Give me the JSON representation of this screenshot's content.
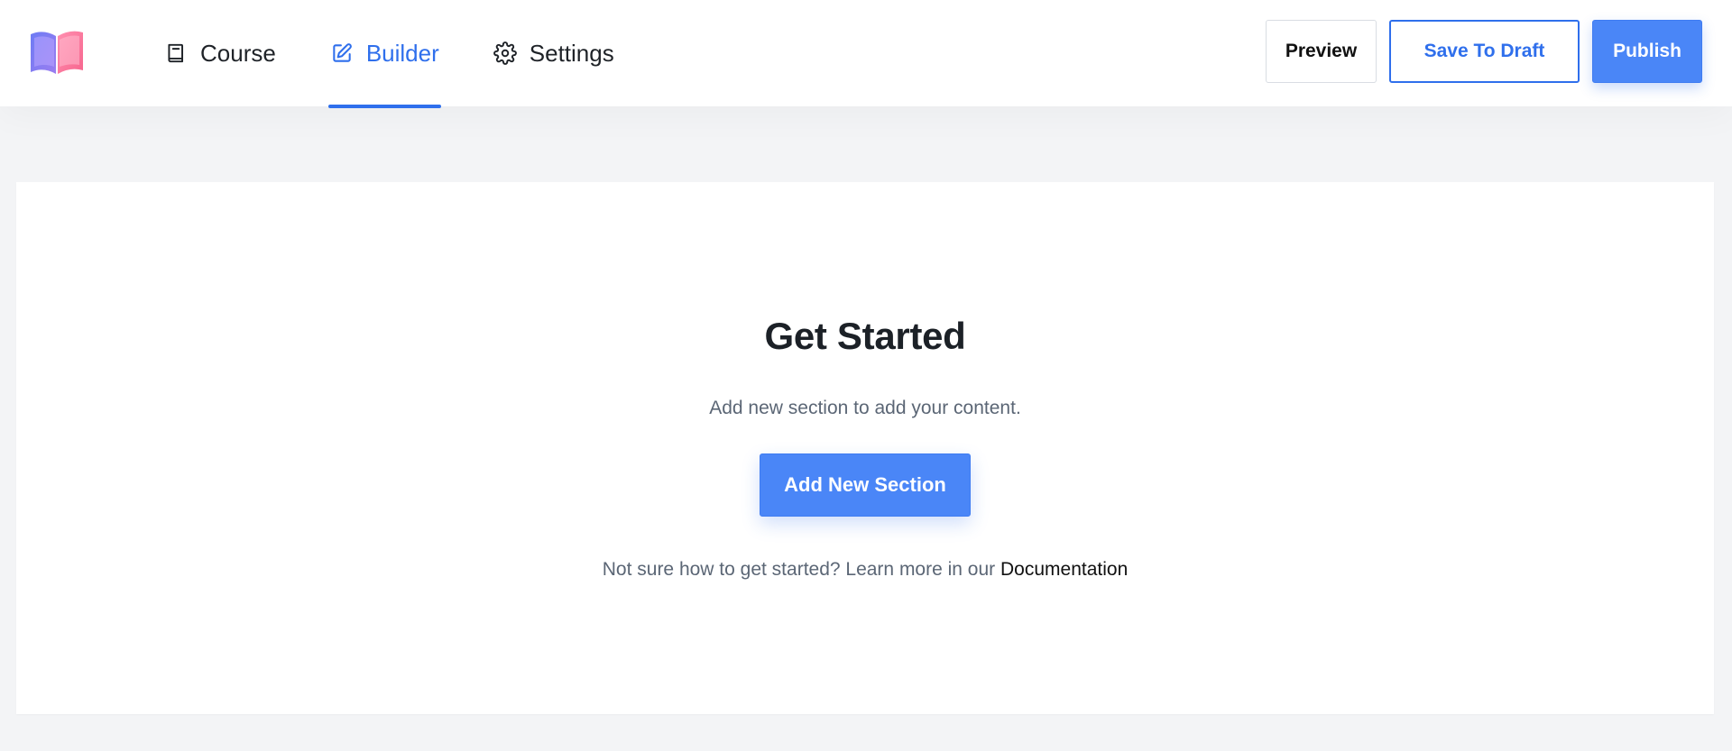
{
  "header": {
    "logo_icon": "open-book-logo-icon",
    "tabs": [
      {
        "label": "Course",
        "icon": "book-icon",
        "active": false
      },
      {
        "label": "Builder",
        "icon": "edit-icon",
        "active": true
      },
      {
        "label": "Settings",
        "icon": "gear-icon",
        "active": false
      }
    ],
    "actions": {
      "preview_label": "Preview",
      "save_draft_label": "Save To Draft",
      "publish_label": "Publish"
    }
  },
  "main": {
    "title": "Get Started",
    "subtitle": "Add new section to add your content.",
    "add_section_label": "Add New Section",
    "help_text": "Not sure how to get started? Learn more in our",
    "help_link": "Documentation"
  },
  "colors": {
    "accent": "#2f6fec",
    "button_fill": "#4a86f7",
    "page_bg": "#f3f4f6"
  }
}
